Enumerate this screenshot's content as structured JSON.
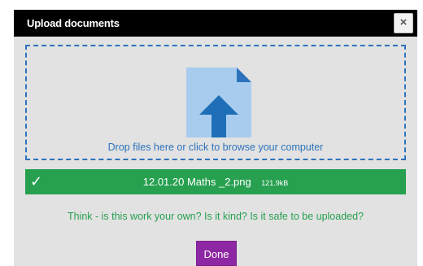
{
  "dialog": {
    "title": "Upload documents",
    "close_label": "×"
  },
  "dropzone": {
    "icon": "upload-file-icon",
    "text": "Drop files here or click to browse your computer"
  },
  "uploaded_files": [
    {
      "status_icon": "✓",
      "name": "12.01.20 Maths _2.png",
      "size": "121.9kB"
    }
  ],
  "notice": "Think - is this work your own? Is it kind? Is it safe to be uploaded?",
  "done_label": "Done",
  "colors": {
    "titlebar": "#000000",
    "dialog_bg": "#e2e2e2",
    "dropzone_border": "#2c73bb",
    "success": "#27a050",
    "done_button": "#8e27a3"
  }
}
